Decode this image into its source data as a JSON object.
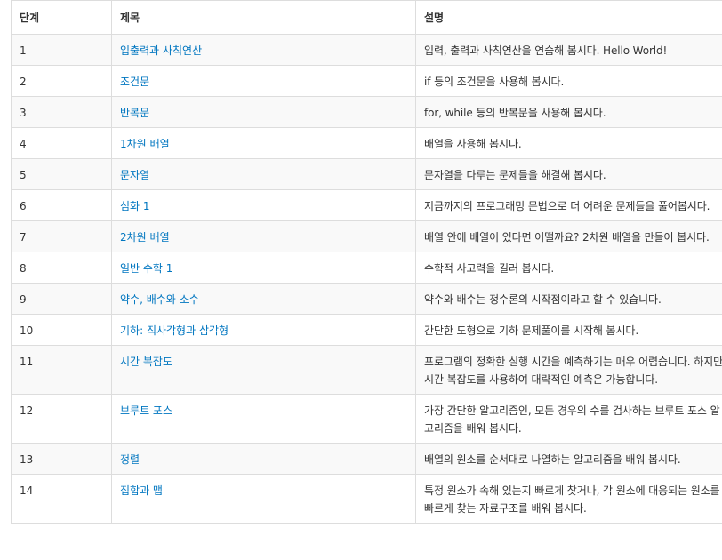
{
  "table": {
    "headers": [
      "단계",
      "제목",
      "설명"
    ],
    "rows": [
      {
        "step": "1",
        "title": "입출력과 사칙연산",
        "desc": "입력, 출력과 사칙연산을 연습해 봅시다. Hello World!"
      },
      {
        "step": "2",
        "title": "조건문",
        "desc": "if 등의 조건문을 사용해 봅시다."
      },
      {
        "step": "3",
        "title": "반복문",
        "desc": "for, while 등의 반복문을 사용해 봅시다."
      },
      {
        "step": "4",
        "title": "1차원 배열",
        "desc": "배열을 사용해 봅시다."
      },
      {
        "step": "5",
        "title": "문자열",
        "desc": "문자열을 다루는 문제들을 해결해 봅시다."
      },
      {
        "step": "6",
        "title": "심화 1",
        "desc": "지금까지의 프로그래밍 문법으로 더 어려운 문제들을 풀어봅시다."
      },
      {
        "step": "7",
        "title": "2차원 배열",
        "desc": "배열 안에 배열이 있다면 어떨까요? 2차원 배열을 만들어 봅시다."
      },
      {
        "step": "8",
        "title": "일반 수학 1",
        "desc": "수학적 사고력을 길러 봅시다."
      },
      {
        "step": "9",
        "title": "약수, 배수와 소수",
        "desc": "약수와 배수는 정수론의 시작점이라고 할 수 있습니다."
      },
      {
        "step": "10",
        "title": "기하: 직사각형과 삼각형",
        "desc": "간단한 도형으로 기하 문제풀이를 시작해 봅시다."
      },
      {
        "step": "11",
        "title": "시간 복잡도",
        "desc": "프로그램의 정확한 실행 시간을 예측하기는 매우 어렵습니다. 하지만 시간 복잡도를 사용하여 대략적인 예측은 가능합니다."
      },
      {
        "step": "12",
        "title": "브루트 포스",
        "desc": "가장 간단한 알고리즘인, 모든 경우의 수를 검사하는 브루트 포스 알고리즘을 배워 봅시다."
      },
      {
        "step": "13",
        "title": "정렬",
        "desc": "배열의 원소를 순서대로 나열하는 알고리즘을 배워 봅시다."
      },
      {
        "step": "14",
        "title": "집합과 맵",
        "desc": "특정 원소가 속해 있는지 빠르게 찾거나, 각 원소에 대응되는 원소를 빠르게 찾는 자료구조를 배워 봅시다."
      }
    ]
  },
  "colors": {
    "link": "#0076c0",
    "border": "#dddddd",
    "stripe": "#f9f9f9",
    "text": "#333333"
  }
}
